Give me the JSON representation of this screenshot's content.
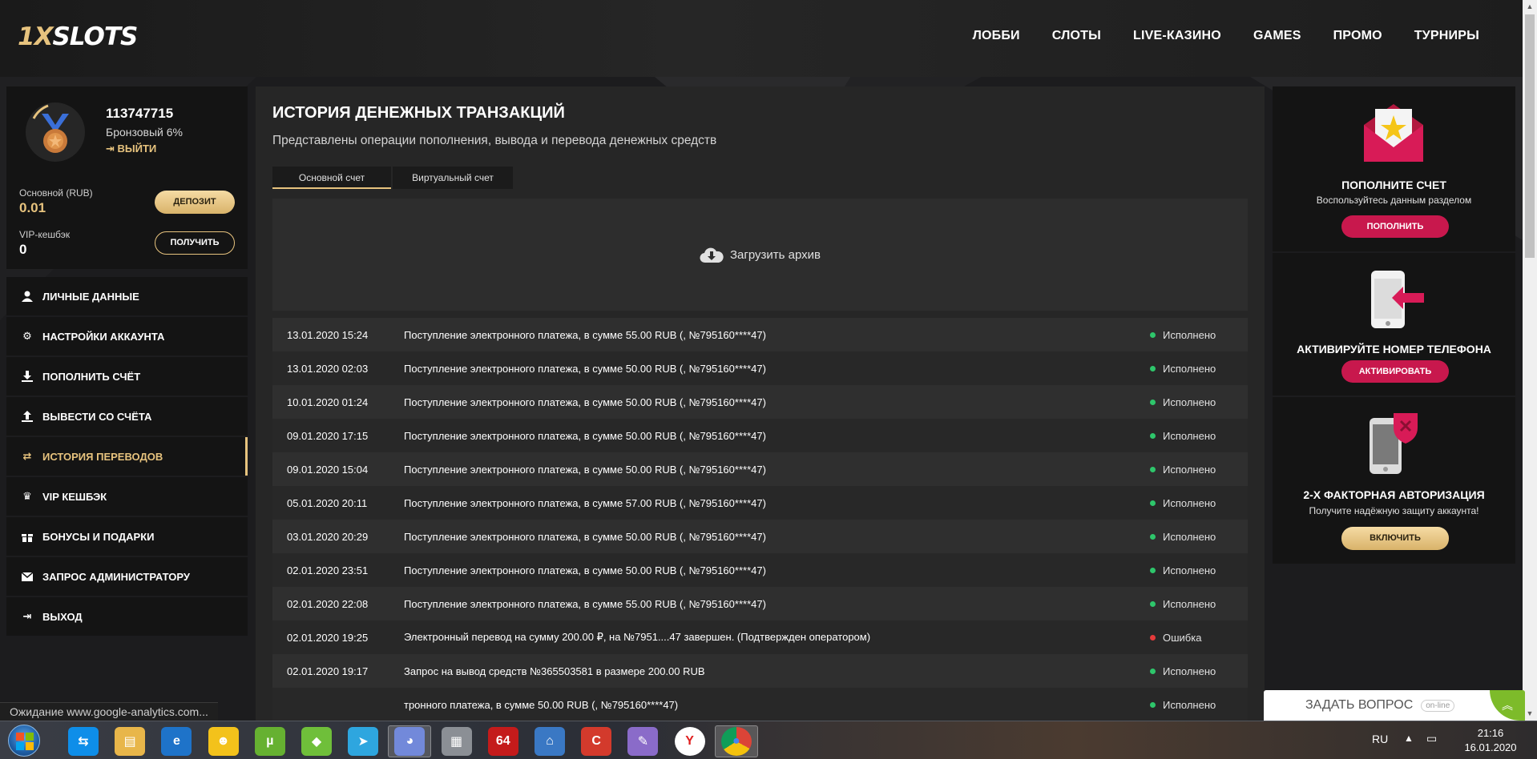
{
  "header": {
    "logo_prefix": "1X",
    "logo_suffix": "SLOTS",
    "nav": [
      "ЛОББИ",
      "СЛОТЫ",
      "LIVE-КАЗИНО",
      "GAMES",
      "ПРОМО",
      "ТУРНИРЫ"
    ]
  },
  "profile": {
    "user_id": "113747715",
    "rank": "Бронзовый 6%",
    "logout_link": "ВЫЙТИ",
    "main_balance_label": "Основной (RUB)",
    "main_balance_value": "0.01",
    "deposit_button": "ДЕПОЗИТ",
    "vip_label": "VIP-кешбэк",
    "vip_value": "0",
    "receive_button": "ПОЛУЧИТЬ"
  },
  "menu": [
    {
      "label": "ЛИЧНЫЕ ДАННЫЕ",
      "icon": "user-icon"
    },
    {
      "label": "НАСТРОЙКИ АККАУНТА",
      "icon": "gears-icon"
    },
    {
      "label": "ПОПОЛНИТЬ СЧЁТ",
      "icon": "download-icon"
    },
    {
      "label": "ВЫВЕСТИ СО СЧЁТА",
      "icon": "upload-icon"
    },
    {
      "label": "ИСТОРИЯ ПЕРЕВОДОВ",
      "icon": "exchange-icon",
      "active": true
    },
    {
      "label": "VIP КЕШБЭК",
      "icon": "crown-icon"
    },
    {
      "label": "БОНУСЫ И ПОДАРКИ",
      "icon": "gift-icon"
    },
    {
      "label": "ЗАПРОС АДМИНИСТРАТОРУ",
      "icon": "envelope-icon"
    },
    {
      "label": "ВЫХОД",
      "icon": "exit-icon"
    }
  ],
  "main": {
    "title": "ИСТОРИЯ ДЕНЕЖНЫХ ТРАНЗАКЦИЙ",
    "subtitle": "Представлены операции пополнения, вывода и перевода денежных средств",
    "tabs": [
      "Основной счет",
      "Виртуальный счет"
    ],
    "archive_label": "Загрузить архив",
    "transactions": [
      {
        "date": "13.01.2020 15:24",
        "desc": "Поступление электронного платежа, в сумме 55.00 RUB (, №795160****47)",
        "status": "Исполнено",
        "ok": true
      },
      {
        "date": "13.01.2020 02:03",
        "desc": "Поступление электронного платежа, в сумме 50.00 RUB (, №795160****47)",
        "status": "Исполнено",
        "ok": true
      },
      {
        "date": "10.01.2020 01:24",
        "desc": "Поступление электронного платежа, в сумме 50.00 RUB (, №795160****47)",
        "status": "Исполнено",
        "ok": true
      },
      {
        "date": "09.01.2020 17:15",
        "desc": "Поступление электронного платежа, в сумме 50.00 RUB (, №795160****47)",
        "status": "Исполнено",
        "ok": true
      },
      {
        "date": "09.01.2020 15:04",
        "desc": "Поступление электронного платежа, в сумме 50.00 RUB (, №795160****47)",
        "status": "Исполнено",
        "ok": true
      },
      {
        "date": "05.01.2020 20:11",
        "desc": "Поступление электронного платежа, в сумме 57.00 RUB (, №795160****47)",
        "status": "Исполнено",
        "ok": true
      },
      {
        "date": "03.01.2020 20:29",
        "desc": "Поступление электронного платежа, в сумме 50.00 RUB (, №795160****47)",
        "status": "Исполнено",
        "ok": true
      },
      {
        "date": "02.01.2020 23:51",
        "desc": "Поступление электронного платежа, в сумме 50.00 RUB (, №795160****47)",
        "status": "Исполнено",
        "ok": true
      },
      {
        "date": "02.01.2020 22:08",
        "desc": "Поступление электронного платежа, в сумме 55.00 RUB (, №795160****47)",
        "status": "Исполнено",
        "ok": true
      },
      {
        "date": "02.01.2020 19:25",
        "desc": "Электронный перевод на сумму 200.00 ₽, на №7951....47 завершен. (Подтвержден оператором)",
        "status": "Ошибка",
        "ok": false
      },
      {
        "date": "02.01.2020 19:17",
        "desc": "Запрос на вывод средств №365503581 в размере 200.00 RUB",
        "status": "Исполнено",
        "ok": true
      },
      {
        "date": "",
        "desc": "тронного платежа, в сумме 50.00 RUB (, №795160****47)",
        "status": "Исполнено",
        "ok": true
      }
    ]
  },
  "promos": [
    {
      "title": "ПОПОЛНИТЕ СЧЕТ",
      "text": "Воспользуйтесь данным разделом",
      "button": "ПОПОЛНИТЬ"
    },
    {
      "title": "АКТИВИРУЙТЕ НОМЕР ТЕЛЕФОНА",
      "text": "",
      "button": "АКТИВИРОВАТЬ"
    },
    {
      "title": "2-Х ФАКТОРНАЯ АВТОРИЗАЦИЯ",
      "text": "Получите надёжную защиту аккаунта!",
      "button": "ВКЛЮЧИТЬ"
    }
  ],
  "chat": {
    "label": "ЗАДАТЬ ВОПРОС",
    "badge": "on-line"
  },
  "browser_status": "Ожидание www.google-analytics.com...",
  "taskbar": {
    "lang": "RU",
    "time": "21:16",
    "date": "16.01.2020",
    "apps": [
      "teamviewer",
      "explorer",
      "internet-explorer",
      "smiley-app",
      "utorrent",
      "bluestacks",
      "telegram",
      "discord",
      "disk-app",
      "aida64",
      "network-app",
      "ccleaner",
      "feather-app",
      "yandex-browser",
      "chrome"
    ]
  },
  "colors": {
    "accent": "#e7c37e",
    "pink": "#c8184d",
    "ok": "#2ec66b",
    "error": "#e53b3b"
  }
}
